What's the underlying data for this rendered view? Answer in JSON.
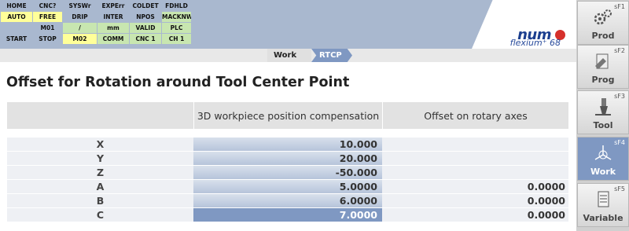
{
  "status_grid": [
    {
      "text": "HOME",
      "style": "blue"
    },
    {
      "text": "CNC?",
      "style": "blue"
    },
    {
      "text": "SYSWr",
      "style": "blue"
    },
    {
      "text": "EXPErr",
      "style": "blue"
    },
    {
      "text": "COLDET",
      "style": "blue"
    },
    {
      "text": "FDHLD",
      "style": "blue"
    },
    {
      "text": "AUTO",
      "style": "yellow"
    },
    {
      "text": "FREE",
      "style": "yellow"
    },
    {
      "text": "DRIP",
      "style": "blue"
    },
    {
      "text": "INTER",
      "style": "blue"
    },
    {
      "text": "NPOS",
      "style": "blue"
    },
    {
      "text": "MACKNW",
      "style": "green"
    },
    {
      "text": "",
      "style": "blue"
    },
    {
      "text": "M01",
      "style": "blue"
    },
    {
      "text": "/",
      "style": "green"
    },
    {
      "text": "mm",
      "style": "green"
    },
    {
      "text": "VALID",
      "style": "green"
    },
    {
      "text": "PLC",
      "style": "green"
    },
    {
      "text": "START",
      "style": "blue"
    },
    {
      "text": "STOP",
      "style": "blue"
    },
    {
      "text": "M02",
      "style": "yellow"
    },
    {
      "text": "COMM",
      "style": "green"
    },
    {
      "text": "CNC 1",
      "style": "green"
    },
    {
      "text": "CH 1",
      "style": "green"
    }
  ],
  "logo": {
    "brand": "num",
    "sub": "flexium⁺ 68"
  },
  "breadcrumb": {
    "work": "Work",
    "rtcp": "RTCP"
  },
  "page_title": "Offset for Rotation around Tool Center Point",
  "table": {
    "headers": [
      "",
      "3D workpiece position compensation",
      "Offset on rotary axes"
    ],
    "rows": [
      {
        "axis": "X",
        "pos": "10.000",
        "rot": ""
      },
      {
        "axis": "Y",
        "pos": "20.000",
        "rot": ""
      },
      {
        "axis": "Z",
        "pos": "-50.000",
        "rot": ""
      },
      {
        "axis": "A",
        "pos": "5.0000",
        "rot": "0.0000"
      },
      {
        "axis": "B",
        "pos": "6.0000",
        "rot": "0.0000"
      },
      {
        "axis": "C",
        "pos": "7.0000",
        "rot": "0.0000"
      }
    ]
  },
  "sidebar": [
    {
      "sf": "sF1",
      "label": "Prod",
      "icon": "gears-icon",
      "active": false
    },
    {
      "sf": "sF2",
      "label": "Prog",
      "icon": "program-icon",
      "active": false
    },
    {
      "sf": "sF3",
      "label": "Tool",
      "icon": "tool-icon",
      "active": false
    },
    {
      "sf": "sF4",
      "label": "Work",
      "icon": "axes-icon",
      "active": true
    },
    {
      "sf": "sF5",
      "label": "Variable",
      "icon": "document-icon",
      "active": false
    }
  ],
  "colors": {
    "header": "#a9b8cf",
    "accent": "#7f98c2",
    "yellow": "#ffff99",
    "green": "#c8e6b0"
  }
}
